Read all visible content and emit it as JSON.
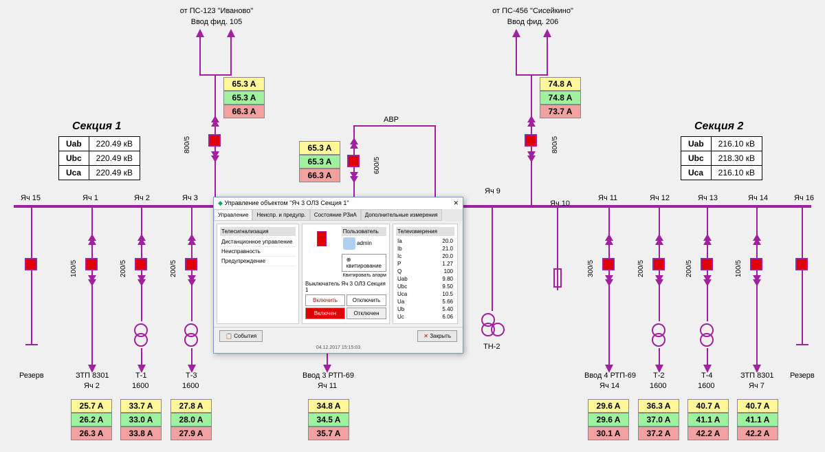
{
  "feed_left": {
    "from": "от ПС-123 \"Иваново\"",
    "line": "Ввод фид. 105"
  },
  "feed_right": {
    "from": "от ПС-456 \"Сисейкино\"",
    "line": "Ввод фид. 206"
  },
  "avr_label": "АВР",
  "section1": {
    "title": "Секция 1",
    "Uab": "220.49 кВ",
    "Ubc": "220.49 кВ",
    "Uca": "220.49 кВ"
  },
  "section2": {
    "title": "Секция 2",
    "Uab": "216.10 кВ",
    "Ubc": "218.30 кВ",
    "Uca": "216.10 кВ"
  },
  "cells": {
    "c15": "Яч 15",
    "c1": "Яч 1",
    "c2": "Яч 2",
    "c3": "Яч 3",
    "c9": "Яч 9",
    "c10": "Яч 10",
    "c11": "Яч 11",
    "c12": "Яч 12",
    "c13": "Яч 13",
    "c14": "Яч 14",
    "c16": "Яч 16"
  },
  "bot": {
    "rez": "Резерв",
    "ztp1": "ЗТП 8301",
    "ztp1_sub": "Яч 2",
    "t1": "Т-1",
    "t1_sub": "1600",
    "t3": "Т-3",
    "t3_sub": "1600",
    "vv3": "Ввод 3 РТП-69",
    "vv3_sub": "Яч 11",
    "tn2": "ТН-2",
    "vv4": "Ввод 4 РТП-69",
    "vv4_sub": "Яч 14",
    "t2": "Т-2",
    "t2_sub": "1600",
    "t4": "Т-4",
    "t4_sub": "1600",
    "ztp2": "ЗТП 8301",
    "ztp2_sub": "Яч 7"
  },
  "meas": {
    "feedL": [
      "65.3 A",
      "65.3 A",
      "66.3 A"
    ],
    "feedR": [
      "74.8 A",
      "74.8 A",
      "73.7 A"
    ],
    "avr": [
      "65.3 A",
      "65.3 A",
      "66.3 A"
    ],
    "c1": [
      "25.7 A",
      "26.2 A",
      "26.3 A"
    ],
    "c2": [
      "33.7 A",
      "33.0 A",
      "33.8 A"
    ],
    "c3": [
      "27.8 A",
      "28.0 A",
      "27.9 A"
    ],
    "vv3": [
      "34.8 A",
      "34.5 A",
      "35.7 A"
    ],
    "c11": [
      "29.6 A",
      "29.6 A",
      "30.1 A"
    ],
    "c12": [
      "36.3 A",
      "37.0 A",
      "37.2 A"
    ],
    "c13": [
      "40.7 A",
      "41.1 A",
      "42.2 A"
    ],
    "c14": [
      "40.7 A",
      "41.1 A",
      "42.2 A"
    ]
  },
  "ratios": {
    "r100": "100/5",
    "r200": "200/5",
    "r300": "300/5",
    "r600": "600/5",
    "r800": "800/5"
  },
  "labels": {
    "Uab": "Uab",
    "Ubc": "Ubc",
    "Uca": "Uca"
  },
  "dialog": {
    "title": "Управление объектом \"Яч 3 ОЛЗ Секция 1\"",
    "tabs": [
      "Управление",
      "Неиспр. и предупр.",
      "Состояние РЗиА",
      "Дополнительные измерения"
    ],
    "telesig": {
      "hdr": "Телесигнализация",
      "rows": [
        "Дистанционное управление",
        "Неисправность",
        "Предупреждение"
      ]
    },
    "user_hdr": "Пользователь",
    "user": "admin",
    "kvit": "квитирование",
    "kvit_all": "Квитировать аларм",
    "sw_label": "Выключатель Яч 3 ОЛЗ Секция 1",
    "btn_vkl": "Включить",
    "btn_otkl": "Отключить",
    "st_on": "Включен",
    "st_off": "Отключен",
    "measurements": {
      "hdr": "Телеизмерения",
      "rows": [
        [
          "Ia",
          "20.0"
        ],
        [
          "Ib",
          "21.0"
        ],
        [
          "Ic",
          "20.0"
        ],
        [
          "P",
          "1.27"
        ],
        [
          "Q",
          "100"
        ],
        [
          "Uab",
          "9.80"
        ],
        [
          "Ubc",
          "9.50"
        ],
        [
          "Uca",
          "10.5"
        ],
        [
          "Ua",
          "5.66"
        ],
        [
          "Ub",
          "5.40"
        ],
        [
          "Uc",
          "6.06"
        ]
      ]
    },
    "events": "События",
    "close": "Закрыть",
    "timestamp": "04.12.2017 15:15:03"
  }
}
